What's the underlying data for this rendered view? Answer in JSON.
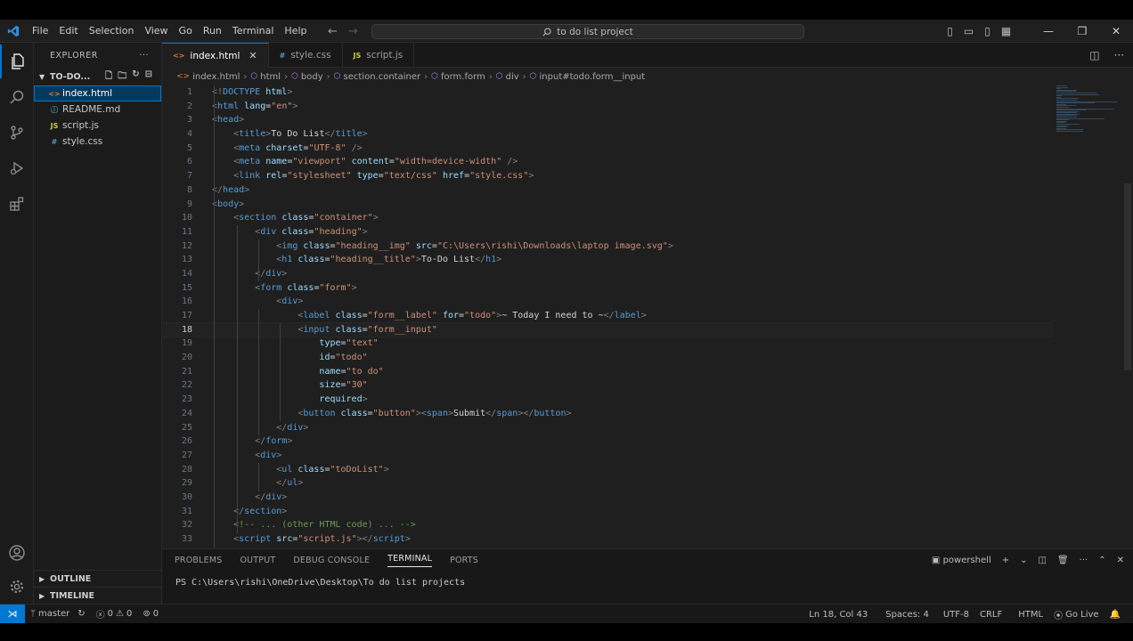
{
  "titlebar": {
    "menu": [
      "File",
      "Edit",
      "Selection",
      "View",
      "Go",
      "Run",
      "Terminal",
      "Help"
    ],
    "search_text": "to do list project"
  },
  "sidebar": {
    "header": "EXPLORER",
    "folder": "TO-DO...",
    "files": [
      {
        "name": "index.html",
        "icon": "<>",
        "color": "#e37933",
        "selected": true
      },
      {
        "name": "README.md",
        "icon": "ⓘ",
        "color": "#519aba",
        "selected": false
      },
      {
        "name": "script.js",
        "icon": "JS",
        "color": "#cbcb41",
        "selected": false
      },
      {
        "name": "style.css",
        "icon": "#",
        "color": "#519aba",
        "selected": false
      }
    ],
    "outline": "OUTLINE",
    "timeline": "TIMELINE"
  },
  "editor": {
    "tabs": [
      {
        "label": "index.html",
        "active": true,
        "icon": "<>",
        "color": "#e37933"
      },
      {
        "label": "style.css",
        "active": false,
        "icon": "#",
        "color": "#519aba"
      },
      {
        "label": "script.js",
        "active": false,
        "icon": "JS",
        "color": "#cbcb41"
      }
    ],
    "breadcrumbs": [
      "index.html",
      "html",
      "body",
      "section.container",
      "form.form",
      "div",
      "input#todo.form__input"
    ],
    "current_line": 18,
    "lines": [
      [
        [
          "p",
          "<!"
        ],
        [
          "t",
          "DOCTYPE"
        ],
        [
          "x",
          " "
        ],
        [
          "a",
          "html"
        ],
        [
          "p",
          ">"
        ]
      ],
      [
        [
          "p",
          "<"
        ],
        [
          "t",
          "html"
        ],
        [
          "x",
          " "
        ],
        [
          "a",
          "lang"
        ],
        [
          "x",
          "="
        ],
        [
          "s",
          "\"en\""
        ],
        [
          "p",
          ">"
        ]
      ],
      [
        [
          "p",
          "<"
        ],
        [
          "t",
          "head"
        ],
        [
          "p",
          ">"
        ]
      ],
      [
        [
          "x",
          "    "
        ],
        [
          "p",
          "<"
        ],
        [
          "t",
          "title"
        ],
        [
          "p",
          ">"
        ],
        [
          "x",
          "To Do List"
        ],
        [
          "p",
          "</"
        ],
        [
          "t",
          "title"
        ],
        [
          "p",
          ">"
        ]
      ],
      [
        [
          "x",
          "    "
        ],
        [
          "p",
          "<"
        ],
        [
          "t",
          "meta"
        ],
        [
          "x",
          " "
        ],
        [
          "a",
          "charset"
        ],
        [
          "x",
          "="
        ],
        [
          "s",
          "\"UTF-8\""
        ],
        [
          "x",
          " "
        ],
        [
          "p",
          "/>"
        ]
      ],
      [
        [
          "x",
          "    "
        ],
        [
          "p",
          "<"
        ],
        [
          "t",
          "meta"
        ],
        [
          "x",
          " "
        ],
        [
          "a",
          "name"
        ],
        [
          "x",
          "="
        ],
        [
          "s",
          "\"viewport\""
        ],
        [
          "x",
          " "
        ],
        [
          "a",
          "content"
        ],
        [
          "x",
          "="
        ],
        [
          "s",
          "\"width=device-width\""
        ],
        [
          "x",
          " "
        ],
        [
          "p",
          "/>"
        ]
      ],
      [
        [
          "x",
          "    "
        ],
        [
          "p",
          "<"
        ],
        [
          "t",
          "link"
        ],
        [
          "x",
          " "
        ],
        [
          "a",
          "rel"
        ],
        [
          "x",
          "="
        ],
        [
          "s",
          "\"stylesheet\""
        ],
        [
          "x",
          " "
        ],
        [
          "a",
          "type"
        ],
        [
          "x",
          "="
        ],
        [
          "s",
          "\"text/css\""
        ],
        [
          "x",
          " "
        ],
        [
          "a",
          "href"
        ],
        [
          "x",
          "="
        ],
        [
          "s",
          "\"style.css\""
        ],
        [
          "p",
          ">"
        ]
      ],
      [
        [
          "p",
          "</"
        ],
        [
          "t",
          "head"
        ],
        [
          "p",
          ">"
        ]
      ],
      [
        [
          "p",
          "<"
        ],
        [
          "t",
          "body"
        ],
        [
          "p",
          ">"
        ]
      ],
      [
        [
          "x",
          "    "
        ],
        [
          "p",
          "<"
        ],
        [
          "t",
          "section"
        ],
        [
          "x",
          " "
        ],
        [
          "a",
          "class"
        ],
        [
          "x",
          "="
        ],
        [
          "s",
          "\"container\""
        ],
        [
          "p",
          ">"
        ]
      ],
      [
        [
          "x",
          "        "
        ],
        [
          "p",
          "<"
        ],
        [
          "t",
          "div"
        ],
        [
          "x",
          " "
        ],
        [
          "a",
          "class"
        ],
        [
          "x",
          "="
        ],
        [
          "s",
          "\"heading\""
        ],
        [
          "p",
          ">"
        ]
      ],
      [
        [
          "x",
          "            "
        ],
        [
          "p",
          "<"
        ],
        [
          "t",
          "img"
        ],
        [
          "x",
          " "
        ],
        [
          "a",
          "class"
        ],
        [
          "x",
          "="
        ],
        [
          "s",
          "\"heading__img\""
        ],
        [
          "x",
          " "
        ],
        [
          "a",
          "src"
        ],
        [
          "x",
          "="
        ],
        [
          "s",
          "\"C:\\Users\\rishi\\Downloads\\laptop image.svg\""
        ],
        [
          "p",
          ">"
        ]
      ],
      [
        [
          "x",
          "            "
        ],
        [
          "p",
          "<"
        ],
        [
          "t",
          "h1"
        ],
        [
          "x",
          " "
        ],
        [
          "a",
          "class"
        ],
        [
          "x",
          "="
        ],
        [
          "s",
          "\"heading__title\""
        ],
        [
          "p",
          ">"
        ],
        [
          "x",
          "To-Do List"
        ],
        [
          "p",
          "</"
        ],
        [
          "t",
          "h1"
        ],
        [
          "p",
          ">"
        ]
      ],
      [
        [
          "x",
          "        "
        ],
        [
          "p",
          "</"
        ],
        [
          "t",
          "div"
        ],
        [
          "p",
          ">"
        ]
      ],
      [
        [
          "x",
          "        "
        ],
        [
          "p",
          "<"
        ],
        [
          "t",
          "form"
        ],
        [
          "x",
          " "
        ],
        [
          "a",
          "class"
        ],
        [
          "x",
          "="
        ],
        [
          "s",
          "\"form\""
        ],
        [
          "p",
          ">"
        ]
      ],
      [
        [
          "x",
          "            "
        ],
        [
          "p",
          "<"
        ],
        [
          "t",
          "div"
        ],
        [
          "p",
          ">"
        ]
      ],
      [
        [
          "x",
          "                "
        ],
        [
          "p",
          "<"
        ],
        [
          "t",
          "label"
        ],
        [
          "x",
          " "
        ],
        [
          "a",
          "class"
        ],
        [
          "x",
          "="
        ],
        [
          "s",
          "\"form__label\""
        ],
        [
          "x",
          " "
        ],
        [
          "a",
          "for"
        ],
        [
          "x",
          "="
        ],
        [
          "s",
          "\"todo\""
        ],
        [
          "p",
          ">"
        ],
        [
          "x",
          "~ Today I need to ~"
        ],
        [
          "p",
          "</"
        ],
        [
          "t",
          "label"
        ],
        [
          "p",
          ">"
        ]
      ],
      [
        [
          "x",
          "                "
        ],
        [
          "p",
          "<"
        ],
        [
          "t",
          "input"
        ],
        [
          "x",
          " "
        ],
        [
          "a",
          "class"
        ],
        [
          "x",
          "="
        ],
        [
          "s",
          "\"form__input\""
        ]
      ],
      [
        [
          "x",
          "                    "
        ],
        [
          "a",
          "type"
        ],
        [
          "x",
          "="
        ],
        [
          "s",
          "\"text\""
        ]
      ],
      [
        [
          "x",
          "                    "
        ],
        [
          "a",
          "id"
        ],
        [
          "x",
          "="
        ],
        [
          "s",
          "\"todo\""
        ]
      ],
      [
        [
          "x",
          "                    "
        ],
        [
          "a",
          "name"
        ],
        [
          "x",
          "="
        ],
        [
          "s",
          "\"to do\""
        ]
      ],
      [
        [
          "x",
          "                    "
        ],
        [
          "a",
          "size"
        ],
        [
          "x",
          "="
        ],
        [
          "s",
          "\"30\""
        ]
      ],
      [
        [
          "x",
          "                    "
        ],
        [
          "a",
          "required"
        ],
        [
          "p",
          ">"
        ]
      ],
      [
        [
          "x",
          "                "
        ],
        [
          "p",
          "<"
        ],
        [
          "t",
          "button"
        ],
        [
          "x",
          " "
        ],
        [
          "a",
          "class"
        ],
        [
          "x",
          "="
        ],
        [
          "s",
          "\"button\""
        ],
        [
          "p",
          ">"
        ],
        [
          "p",
          "<"
        ],
        [
          "t",
          "span"
        ],
        [
          "p",
          ">"
        ],
        [
          "x",
          "Submit"
        ],
        [
          "p",
          "</"
        ],
        [
          "t",
          "span"
        ],
        [
          "p",
          ">"
        ],
        [
          "p",
          "</"
        ],
        [
          "t",
          "button"
        ],
        [
          "p",
          ">"
        ]
      ],
      [
        [
          "x",
          "            "
        ],
        [
          "p",
          "</"
        ],
        [
          "t",
          "div"
        ],
        [
          "p",
          ">"
        ]
      ],
      [
        [
          "x",
          "        "
        ],
        [
          "p",
          "</"
        ],
        [
          "t",
          "form"
        ],
        [
          "p",
          ">"
        ]
      ],
      [
        [
          "x",
          "        "
        ],
        [
          "p",
          "<"
        ],
        [
          "t",
          "div"
        ],
        [
          "p",
          ">"
        ]
      ],
      [
        [
          "x",
          "            "
        ],
        [
          "p",
          "<"
        ],
        [
          "t",
          "ul"
        ],
        [
          "x",
          " "
        ],
        [
          "a",
          "class"
        ],
        [
          "x",
          "="
        ],
        [
          "s",
          "\"toDoList\""
        ],
        [
          "p",
          ">"
        ]
      ],
      [
        [
          "x",
          "            "
        ],
        [
          "p",
          "</"
        ],
        [
          "t",
          "ul"
        ],
        [
          "p",
          ">"
        ]
      ],
      [
        [
          "x",
          "        "
        ],
        [
          "p",
          "</"
        ],
        [
          "t",
          "div"
        ],
        [
          "p",
          ">"
        ]
      ],
      [
        [
          "x",
          "    "
        ],
        [
          "p",
          "</"
        ],
        [
          "t",
          "section"
        ],
        [
          "p",
          ">"
        ]
      ],
      [
        [
          "x",
          "    "
        ],
        [
          "c",
          "<!-- ... (other HTML code) ... -->"
        ]
      ],
      [
        [
          "x",
          "    "
        ],
        [
          "p",
          "<"
        ],
        [
          "t",
          "script"
        ],
        [
          "x",
          " "
        ],
        [
          "a",
          "src"
        ],
        [
          "x",
          "="
        ],
        [
          "s",
          "\"script.js\""
        ],
        [
          "p",
          ">"
        ],
        [
          "p",
          "</"
        ],
        [
          "t",
          "script"
        ],
        [
          "p",
          ">"
        ]
      ]
    ]
  },
  "panel": {
    "tabs": [
      {
        "label": "PROBLEMS",
        "active": false
      },
      {
        "label": "OUTPUT",
        "active": false
      },
      {
        "label": "DEBUG CONSOLE",
        "active": false
      },
      {
        "label": "TERMINAL",
        "active": true
      },
      {
        "label": "PORTS",
        "active": false
      }
    ],
    "shell": "powershell",
    "terminal_line": "PS C:\\Users\\rishi\\OneDrive\\Desktop\\To do list projects"
  },
  "statusbar": {
    "branch": "master",
    "errors": "0",
    "warnings": "0",
    "ports": "0",
    "position": "Ln 18, Col 43",
    "spaces": "Spaces: 4",
    "encoding": "UTF-8",
    "eol": "CRLF",
    "language": "HTML",
    "golive": "Go Live"
  },
  "colors": {
    "accent": "#0078d4",
    "background": "#1f1f1f",
    "selection": "#04395e"
  }
}
